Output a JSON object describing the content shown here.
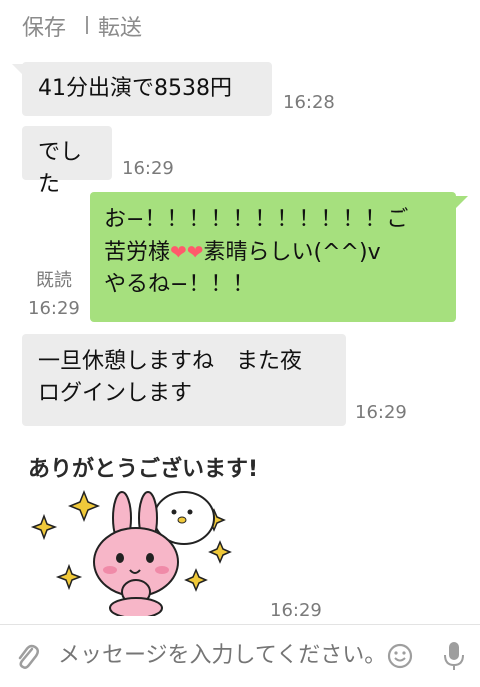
{
  "top": {
    "save": "保存",
    "forward": "転送"
  },
  "messages": [
    {
      "text": "41分出演で8538円",
      "time": "16:28"
    },
    {
      "text": "でした",
      "time": "16:29"
    },
    {
      "line1": "お−！！！！！！！！！！！ご",
      "line2a": "苦労様",
      "line2b": "素晴らしい(^^)v",
      "line3": "やるね−！！！",
      "time": "16:29",
      "read": "既読"
    },
    {
      "line1": "一旦休憩しますね　また夜",
      "line2": "ログインします",
      "time": "16:29"
    },
    {
      "sticker_text": "ありがとうございます!",
      "time": "16:29"
    }
  ],
  "input": {
    "placeholder": "メッセージを入力してください。"
  },
  "icons": {
    "attach": "paperclip-icon",
    "emoji": "smiley-icon",
    "mic": "microphone-icon"
  },
  "colors": {
    "outgoing": "#a6e07e",
    "incoming": "#ececec",
    "sticker_pink": "#f7b6c8"
  }
}
